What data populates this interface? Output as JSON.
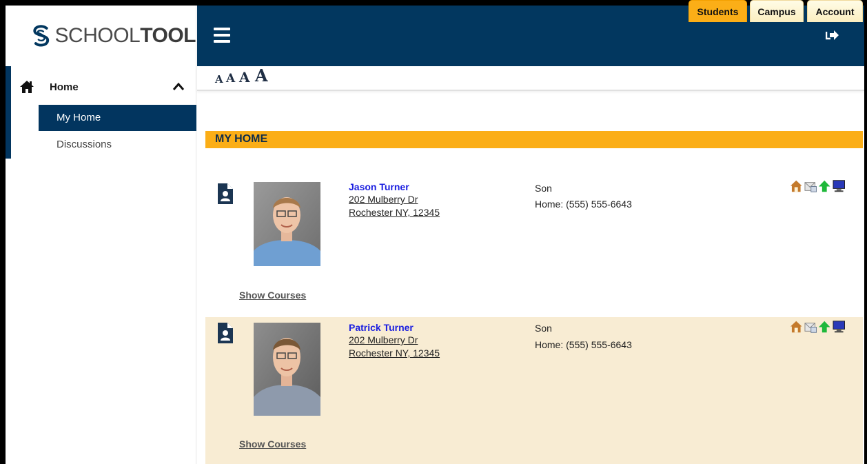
{
  "logo": {
    "text_light": "SCHOOL",
    "text_bold": "TOOL"
  },
  "sidebar": {
    "section_label": "Home",
    "items": [
      {
        "label": "My Home",
        "active": true
      },
      {
        "label": "Discussions",
        "active": false
      }
    ]
  },
  "fontsize": {
    "a1": "A",
    "a2": "A",
    "a3": "A",
    "a4": "A"
  },
  "tabs": [
    {
      "label": "Students",
      "active": true
    },
    {
      "label": "Campus",
      "active": false
    },
    {
      "label": "Account",
      "active": false
    }
  ],
  "page_title": "MY HOME",
  "students": [
    {
      "name": "Jason Turner",
      "address1": "202 Mulberry Dr",
      "address2": "Rochester NY, 12345",
      "relation": "Son",
      "phone": "Home: (555) 555-6643",
      "show_courses": "Show Courses"
    },
    {
      "name": "Patrick Turner",
      "address1": "202 Mulberry Dr",
      "address2": "Rochester NY, 12345",
      "relation": "Son",
      "phone": "Home: (555) 555-6643",
      "show_courses": "Show Courses"
    }
  ],
  "colors": {
    "navy": "#02375f",
    "gold": "#fbae17",
    "alt_row": "#f8ecd3",
    "link": "#1a1ee0"
  },
  "icons": [
    "house-icon",
    "mail-icon",
    "up-arrow-icon",
    "computer-icon"
  ]
}
